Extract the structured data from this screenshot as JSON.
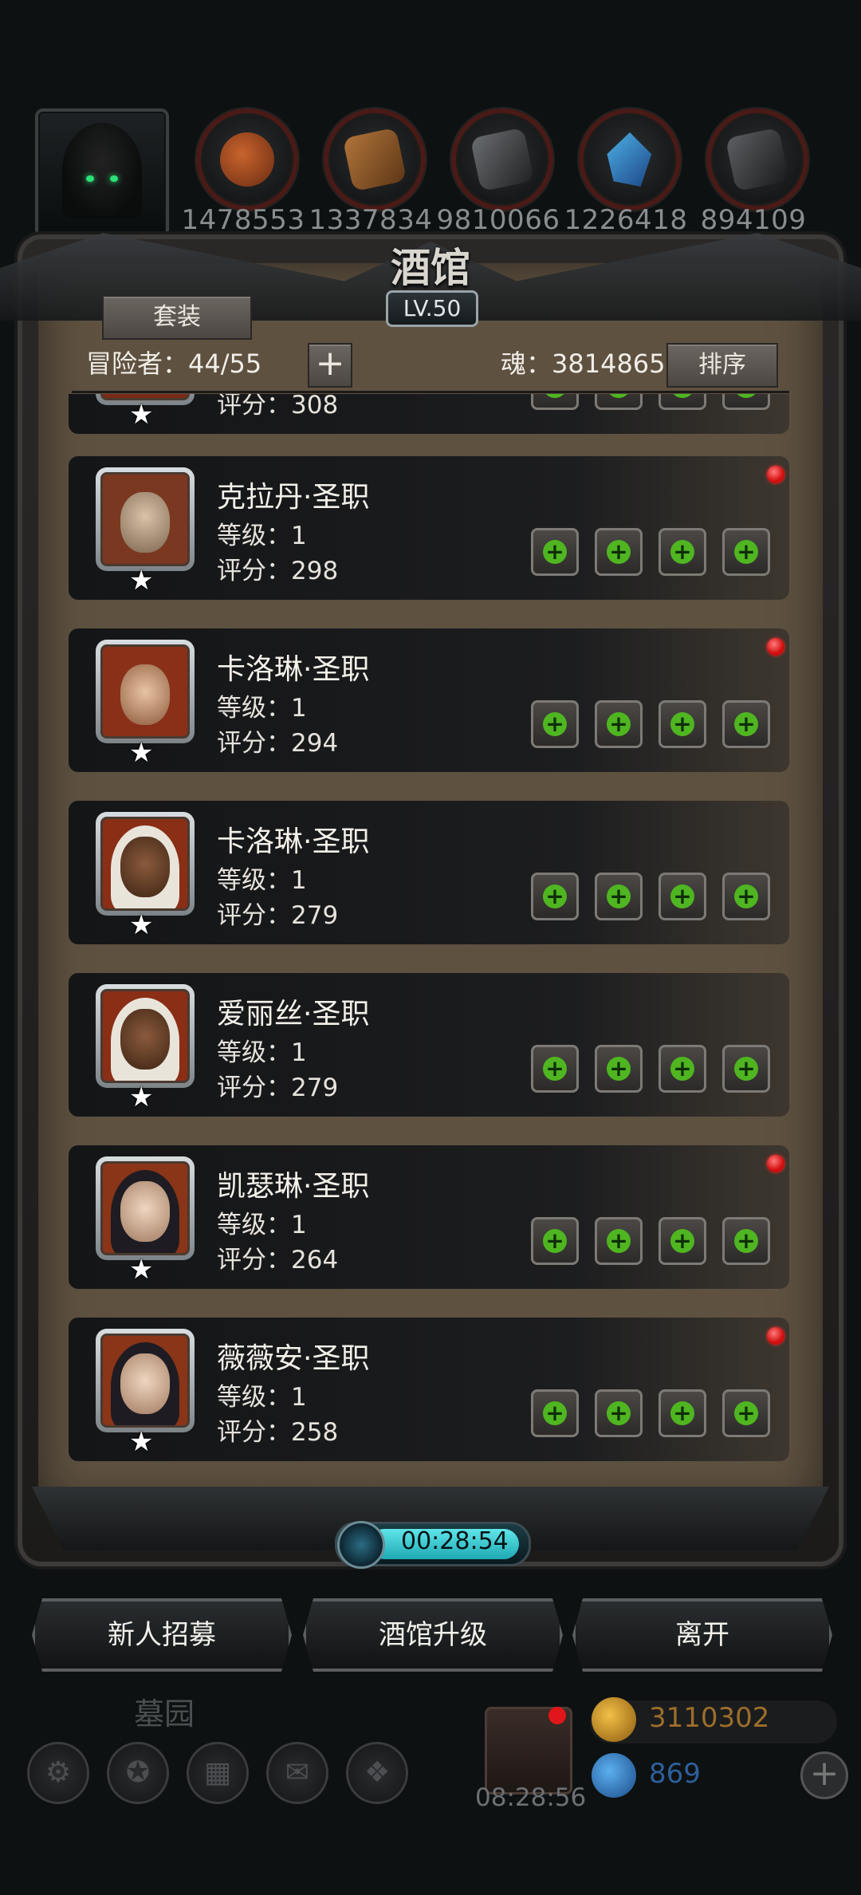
{
  "top_resources": {
    "values": [
      "1478553",
      "1337834",
      "9810066",
      "1226418",
      "894109"
    ],
    "icon_names": [
      "meat-icon",
      "wood-icon",
      "iron-icon",
      "crystal-icon",
      "coal-icon"
    ]
  },
  "panel": {
    "title": "酒馆",
    "level_badge": "LV.50",
    "set_button": "套装",
    "adventurer_label": "冒险者：44/55",
    "add_label": "+",
    "soul_label": "魂：3814865",
    "sort_button": "排序"
  },
  "heroes": [
    {
      "name": "",
      "level": "",
      "score": "评分：308",
      "has_dot": false,
      "portrait_color": "#7a2a18"
    },
    {
      "name": "克拉丹·圣职",
      "level": "等级：1",
      "score": "评分：298",
      "has_dot": true,
      "portrait_color": "#7a3820"
    },
    {
      "name": "卡洛琳·圣职",
      "level": "等级：1",
      "score": "评分：294",
      "has_dot": true,
      "portrait_color": "#8a3018"
    },
    {
      "name": "卡洛琳·圣职",
      "level": "等级：1",
      "score": "评分：279",
      "has_dot": false,
      "portrait_color": "#8a2e16"
    },
    {
      "name": "爱丽丝·圣职",
      "level": "等级：1",
      "score": "评分：279",
      "has_dot": false,
      "portrait_color": "#8a2e16"
    },
    {
      "name": "凯瑟琳·圣职",
      "level": "等级：1",
      "score": "评分：264",
      "has_dot": true,
      "portrait_color": "#8a3418"
    },
    {
      "name": "薇薇安·圣职",
      "level": "等级：1",
      "score": "评分：258",
      "has_dot": true,
      "portrait_color": "#8a3418"
    }
  ],
  "timer": "00:28:54",
  "actions": {
    "recruit": "新人招募",
    "upgrade": "酒馆升级",
    "leave": "离开"
  },
  "footer": {
    "area_label": "墓园",
    "gift_timer": "08:28:56",
    "gold": "3110302",
    "gems": "869",
    "plus": "+"
  },
  "colors": {
    "accent_green": "#4fb521",
    "notify_red": "#d10d0d",
    "timer_cyan": "#5fe6ea"
  }
}
